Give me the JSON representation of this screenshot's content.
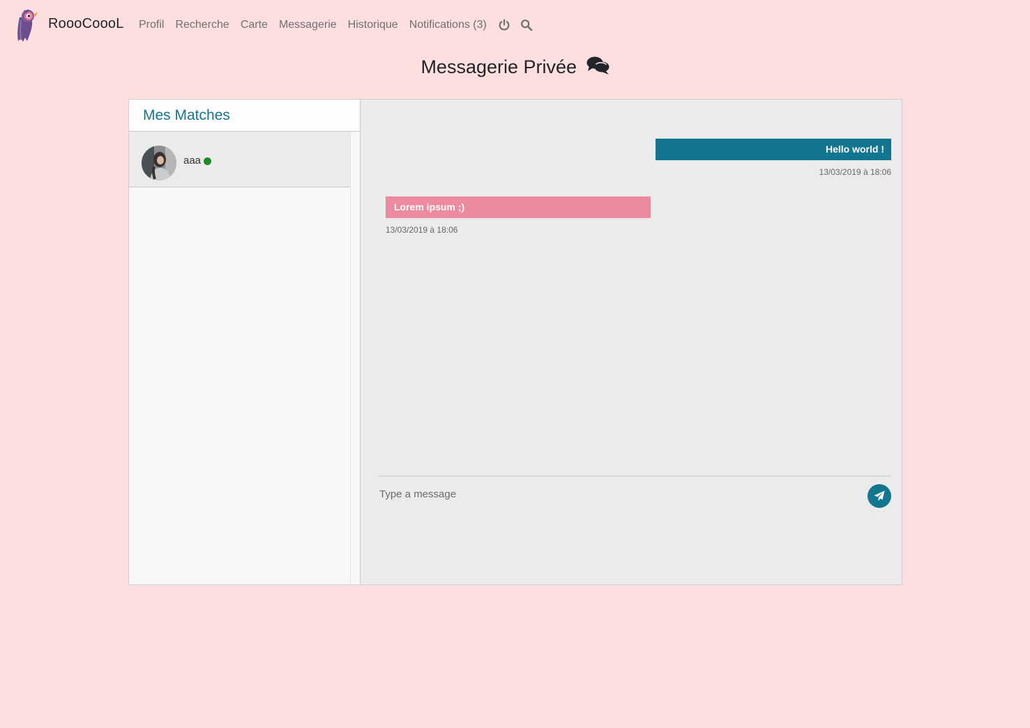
{
  "brand": {
    "name": "RoooCoooL",
    "logo_icon": "pink-bird-logo-icon"
  },
  "nav": {
    "links": [
      "Profil",
      "Recherche",
      "Carte",
      "Messagerie",
      "Historique",
      "Notifications (3)"
    ],
    "icons": [
      "power-icon",
      "search-icon"
    ]
  },
  "page": {
    "title": "Messagerie Privée",
    "title_icon": "comments-icon"
  },
  "sidebar": {
    "header": "Mes Matches",
    "matches": [
      {
        "name": "aaa",
        "online": true,
        "status_color": "#1e8a2a"
      }
    ]
  },
  "messages": [
    {
      "direction": "out",
      "text": "Hello world !",
      "timestamp": "13/03/2019 à 18:06"
    },
    {
      "direction": "in",
      "text": "Lorem ipsum ;)",
      "timestamp": "13/03/2019 à 18:06"
    }
  ],
  "composer": {
    "placeholder": "Type a message",
    "send_icon": "paper-plane-icon"
  },
  "colors": {
    "background": "#fddfe0",
    "accent": "#137690",
    "incoming_bubble": "#ec8aa0",
    "chat_panel": "#ebebeb"
  }
}
